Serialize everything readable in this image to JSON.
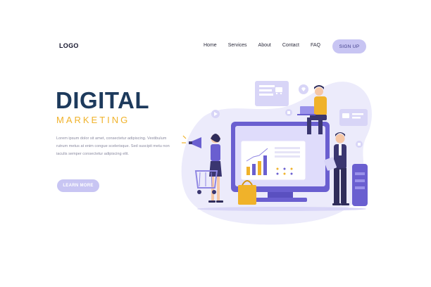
{
  "header": {
    "logo": "LOGO",
    "nav": [
      "Home",
      "Services",
      "About",
      "Contact",
      "FAQ"
    ],
    "signup": "SIGN UP"
  },
  "hero": {
    "title": "DIGITAL",
    "subtitle": "MARKETING",
    "body": "Lorem ipsum dolor sit amet, consectetur adipiscing. Vestibulum rutrum metus at enim congue scelerisque. Sed suscipit metu non iaculis semper consectetur adipiscing elit.",
    "cta": "LEARN MORE"
  },
  "colors": {
    "title": "#1d3a5c",
    "accent": "#f0b22a",
    "button": "#c8c5f3",
    "illustration_purple": "#6a5fd0",
    "blob": "#e9e7fb"
  },
  "illustration": {
    "icons": [
      "megaphone-icon",
      "shopping-cart-icon",
      "shopping-bag-icon",
      "like-icon",
      "play-icon",
      "heart-icon",
      "bar-chart-icon",
      "laptop-icon"
    ]
  }
}
